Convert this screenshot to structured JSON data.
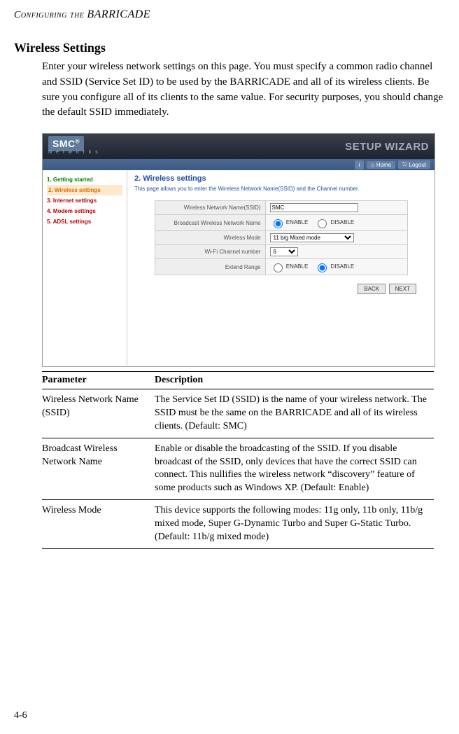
{
  "running_head_left": "Configuring the",
  "running_head_brand": "BARRICADE",
  "section_title": "Wireless Settings",
  "intro": "Enter your wireless network settings on this page. You must specify a common radio channel and SSID (Service Set ID) to be used by the BARRICADE and all of its wireless clients. Be sure you configure all of its clients to the same value. For security purposes, you should change the default SSID immediately.",
  "screenshot": {
    "logo_text": "SMC",
    "logo_r": "®",
    "logo_sub": "N e t w o r k s",
    "wizard_title": "SETUP WIZARD",
    "home_btn": "Home",
    "logout_btn": "Logout",
    "nav": [
      {
        "num": "1.",
        "label": "Getting started",
        "cls": "nav-green"
      },
      {
        "num": "2.",
        "label": "Wireless settings",
        "cls": "nav-orange"
      },
      {
        "num": "3.",
        "label": "Internet settings",
        "cls": "nav-red"
      },
      {
        "num": "4.",
        "label": "Modem settings",
        "cls": "nav-red"
      },
      {
        "num": "5.",
        "label": "ADSL settings",
        "cls": "nav-red"
      }
    ],
    "main_title": "2. Wireless settings",
    "main_sub": "This page allows you to enter the Wireless Network Name(SSID) and the Channel number.",
    "rows": {
      "ssid_label": "Wireless Network Name(SSID)",
      "ssid_value": "SMC",
      "bcast_label": "Broadcast Wireless Network Name",
      "enable": "ENABLE",
      "disable": "DISABLE",
      "mode_label": "Wireless Mode",
      "mode_value": "11 b/g Mixed mode",
      "chan_label": "Wi-Fi Channel number",
      "chan_value": "6",
      "range_label": "Extend Range"
    },
    "back_btn": "BACK",
    "next_btn": "NEXT"
  },
  "table_head_param": "Parameter",
  "table_head_desc": "Description",
  "params": [
    {
      "name": "Wireless Network Name (SSID)",
      "desc": "The Service Set ID (SSID) is the name of your wireless network. The SSID must be the same on the BARRICADE and all of its wireless clients. (Default: SMC)"
    },
    {
      "name": "Broadcast Wireless Network Name",
      "desc": "Enable or disable the broadcasting of the SSID. If you disable broadcast of the SSID, only devices that have the correct SSID can connect. This nullifies the wireless network “discovery” feature of some products such as Windows XP. (Default: Enable)"
    },
    {
      "name": "Wireless Mode",
      "desc": "This device supports the following modes: 11g only, 11b only, 11b/g mixed mode, Super G-Dynamic Turbo and Super G-Static Turbo. (Default: 11b/g mixed mode)"
    }
  ],
  "page_number": "4-6"
}
